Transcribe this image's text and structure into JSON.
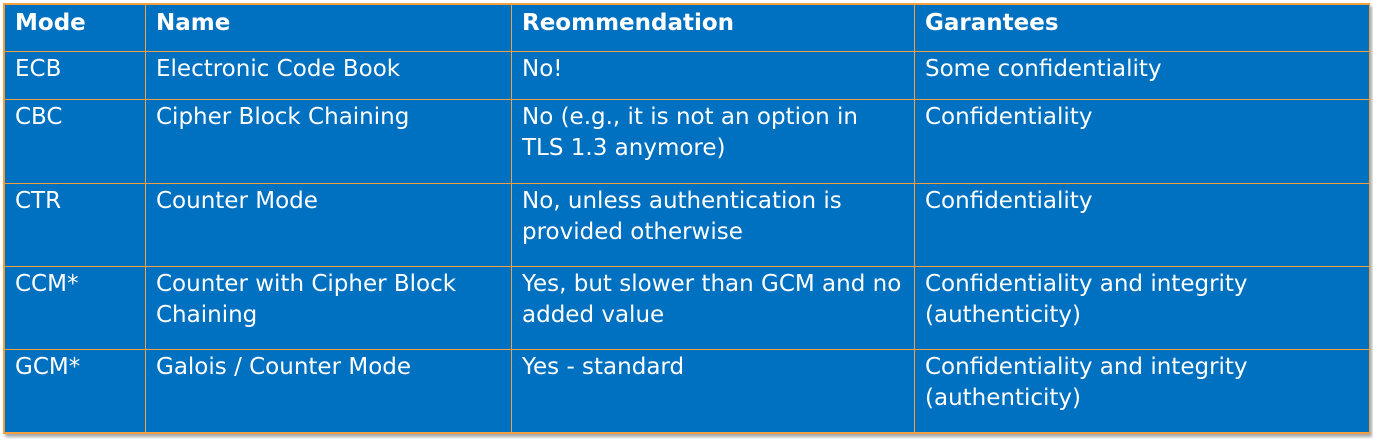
{
  "table": {
    "headers": [
      "Mode",
      "Name",
      "Reommendation",
      "Garantees"
    ],
    "rows": [
      {
        "mode": "ECB",
        "name": "Electronic Code Book",
        "recommendation": "No!",
        "guarantees": "Some confidentiality"
      },
      {
        "mode": "CBC",
        "name": "Cipher Block Chaining",
        "recommendation": "No (e.g., it is not an option in TLS 1.3 anymore)",
        "guarantees": "Confidentiality"
      },
      {
        "mode": "CTR",
        "name": "Counter Mode",
        "recommendation": "No, unless authentication is provided otherwise",
        "guarantees": "Confidentiality"
      },
      {
        "mode": "CCM*",
        "name": "Counter with Cipher Block Chaining",
        "recommendation": "Yes, but slower than GCM and no added value",
        "guarantees": "Confidentiality and integrity (authenticity)"
      },
      {
        "mode": "GCM*",
        "name": "Galois / Counter Mode",
        "recommendation": "Yes - standard",
        "guarantees": "Confidentiality and integrity (authenticity)"
      }
    ]
  },
  "colors": {
    "cell_background": "#0070c0",
    "border": "#f0a040",
    "text": "#ffffff"
  }
}
